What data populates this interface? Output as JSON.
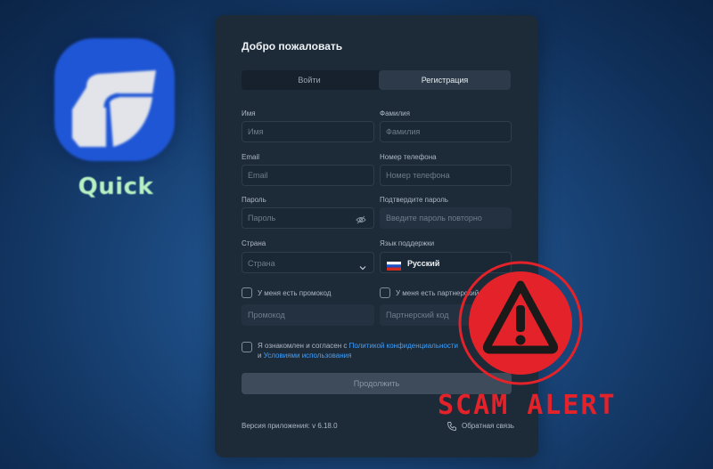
{
  "app": {
    "name": "Quick",
    "icon": "quick-app-logo-icon",
    "icon_color": "#1f56d6"
  },
  "panel": {
    "title": "Добро пожаловать",
    "tabs": [
      {
        "label": "Войти",
        "active": false
      },
      {
        "label": "Регистрация",
        "active": true
      }
    ],
    "fields": {
      "first_name": {
        "label": "Имя",
        "placeholder": "Имя"
      },
      "last_name": {
        "label": "Фамилия",
        "placeholder": "Фамилия"
      },
      "email": {
        "label": "Email",
        "placeholder": "Email"
      },
      "phone": {
        "label": "Номер телефона",
        "placeholder": "Номер телефона"
      },
      "password": {
        "label": "Пароль",
        "placeholder": "Пароль",
        "icon": "eye-off-icon"
      },
      "confirm_password": {
        "label": "Подтвердите пароль",
        "placeholder": "Введите пароль повторно"
      },
      "country": {
        "label": "Страна",
        "placeholder": "Страна"
      },
      "support_language": {
        "label": "Язык поддержки",
        "value": "Русский",
        "flag": "russia-flag-icon"
      },
      "promo_code": {
        "checkbox_label": "У меня есть промокод",
        "placeholder": "Промокод"
      },
      "partner_code": {
        "checkbox_label": "У меня есть партнерский",
        "placeholder": "Партнерский код"
      }
    },
    "terms": {
      "prefix": "Я ознакомлен и согласен с ",
      "privacy_link": "Политикой конфиденциальности",
      "and": "и ",
      "terms_link": "Условиями использования"
    },
    "continue_label": "Продолжить",
    "version": "Версия приложения: v 6.18.0",
    "feedback": "Обратная связь",
    "accent_color": "#3ea0ff"
  },
  "overlay": {
    "scam_text": "SCAM ALERT",
    "color": "#e3222a",
    "icon": "warning-triangle-icon"
  }
}
